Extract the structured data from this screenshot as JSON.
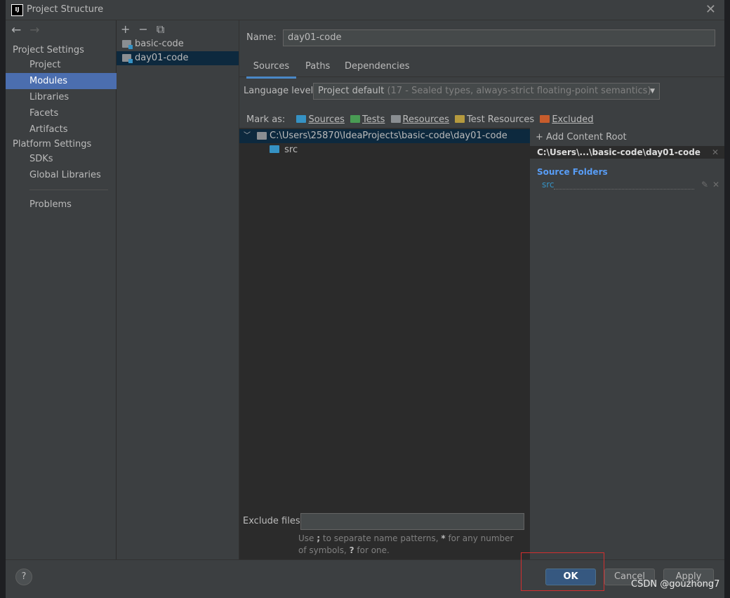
{
  "window": {
    "title": "Project Structure",
    "icon_text": "IJ"
  },
  "nav": {
    "back": "←",
    "forward": "→",
    "project_settings_heading": "Project Settings",
    "items_top": [
      "Project",
      "Modules",
      "Libraries",
      "Facets",
      "Artifacts"
    ],
    "selected": "Modules",
    "platform_settings_heading": "Platform Settings",
    "items_platform": [
      "SDKs",
      "Global Libraries"
    ],
    "problems": "Problems"
  },
  "modules": {
    "toolbar": [
      "+",
      "−",
      "⧉"
    ],
    "items": [
      "basic-code",
      "day01-code"
    ],
    "selected": "day01-code"
  },
  "main": {
    "name_label": "Name:",
    "name_value": "day01-code",
    "tabs": [
      "Sources",
      "Paths",
      "Dependencies"
    ],
    "active_tab": "Sources",
    "language_label": "Language level:",
    "language_value": "Project default",
    "language_detail": "(17 - Sealed types, always-strict floating-point semantics)",
    "mark_as_label": "Mark as:",
    "mark_as": [
      {
        "label": "Sources",
        "color": "#3592c4"
      },
      {
        "label": "Tests",
        "color": "#499c54"
      },
      {
        "label": "Resources",
        "color": "#8a8e92"
      },
      {
        "label": "Test Resources",
        "color": "#b59a3e"
      },
      {
        "label": "Excluded",
        "color": "#c75c2c"
      }
    ],
    "tree_root": "C:\\Users\\25870\\IdeaProjects\\basic-code\\day01-code",
    "tree_child": "src",
    "add_content_root": "Add Content Root",
    "content_root_short": "C:\\Users\\...\\basic-code\\day01-code",
    "source_folders_heading": "Source Folders",
    "source_folder": "src",
    "exclude_label": "Exclude files:",
    "exclude_value": "",
    "hint_1": "Use ",
    "hint_semicolon": ";",
    "hint_2": " to separate name patterns, ",
    "hint_star": "*",
    "hint_3": " for any number of symbols, ",
    "hint_q": "?",
    "hint_4": " for one."
  },
  "footer": {
    "help": "?",
    "ok": "OK",
    "cancel": "Cancel",
    "apply": "Apply"
  },
  "watermark": "CSDN @gouzhong7",
  "colors": {
    "accent": "#4b6eaf",
    "ok_button": "#365880",
    "highlight_box": "#d32f2f"
  }
}
